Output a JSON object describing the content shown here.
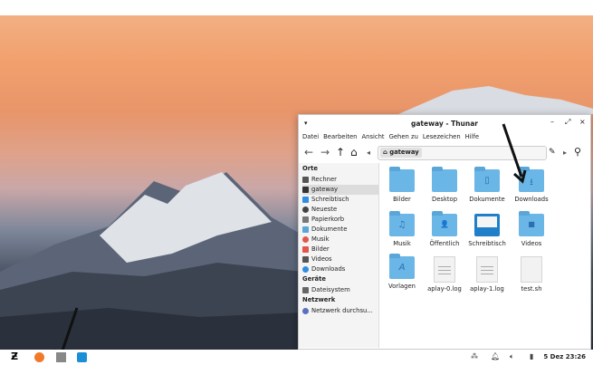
{
  "window": {
    "title": "gateway - Thunar",
    "controls": {
      "minimize": "–",
      "maximize": "⤢",
      "close": "×"
    },
    "menu": [
      "Datei",
      "Bearbeiten",
      "Ansicht",
      "Gehen zu",
      "Lesezeichen",
      "Hilfe"
    ],
    "path_crumb": "gateway",
    "sidebar": {
      "sections": [
        {
          "title": "Orte",
          "items": [
            {
              "label": "Rechner",
              "icon": "computer-icon",
              "color": "#555555"
            },
            {
              "label": "gateway",
              "icon": "home-icon",
              "color": "#333333",
              "selected": true
            },
            {
              "label": "Schreibtisch",
              "icon": "desktop-icon",
              "color": "#2f8ee0"
            },
            {
              "label": "Neueste",
              "icon": "clock-icon",
              "color": "#444444"
            },
            {
              "label": "Papierkorb",
              "icon": "trash-icon",
              "color": "#777777"
            },
            {
              "label": "Dokumente",
              "icon": "documents-icon",
              "color": "#5aa6d9"
            },
            {
              "label": "Musik",
              "icon": "music-icon",
              "color": "#e2574c"
            },
            {
              "label": "Bilder",
              "icon": "pictures-icon",
              "color": "#e2574c"
            },
            {
              "label": "Videos",
              "icon": "videos-icon",
              "color": "#555555"
            },
            {
              "label": "Downloads",
              "icon": "downloads-icon",
              "color": "#2f8ee0"
            }
          ]
        },
        {
          "title": "Geräte",
          "items": [
            {
              "label": "Dateisystem",
              "icon": "drive-icon",
              "color": "#666666"
            }
          ]
        },
        {
          "title": "Netzwerk",
          "items": [
            {
              "label": "Netzwerk durchsu...",
              "icon": "network-icon",
              "color": "#5a6fbf"
            }
          ]
        }
      ]
    },
    "files": [
      {
        "name": "Bilder",
        "type": "folder",
        "glyph": ""
      },
      {
        "name": "Desktop",
        "type": "folder",
        "glyph": ""
      },
      {
        "name": "Dokumente",
        "type": "folder",
        "glyph": "▯"
      },
      {
        "name": "Downloads",
        "type": "folder",
        "glyph": "⭳"
      },
      {
        "name": "Musik",
        "type": "folder",
        "glyph": "♫"
      },
      {
        "name": "Öffentlich",
        "type": "folder",
        "glyph": "👤"
      },
      {
        "name": "Schreibtisch",
        "type": "folder-dark",
        "glyph": ""
      },
      {
        "name": "Videos",
        "type": "folder",
        "glyph": "■"
      },
      {
        "name": "Vorlagen",
        "type": "folder",
        "glyph": "A"
      },
      {
        "name": "aplay-0.log",
        "type": "doc",
        "glyph": ""
      },
      {
        "name": "aplay-1.log",
        "type": "doc",
        "glyph": ""
      },
      {
        "name": "test.sh",
        "type": "doc",
        "glyph": ""
      }
    ]
  },
  "taskbar": {
    "clock": "5 Dez 23:26",
    "tray_icons": [
      "network-icon",
      "bell-icon",
      "volume-icon",
      "battery-icon"
    ]
  },
  "colors": {
    "accent": "#2f8ee0",
    "folder": "#6ab6e6"
  }
}
